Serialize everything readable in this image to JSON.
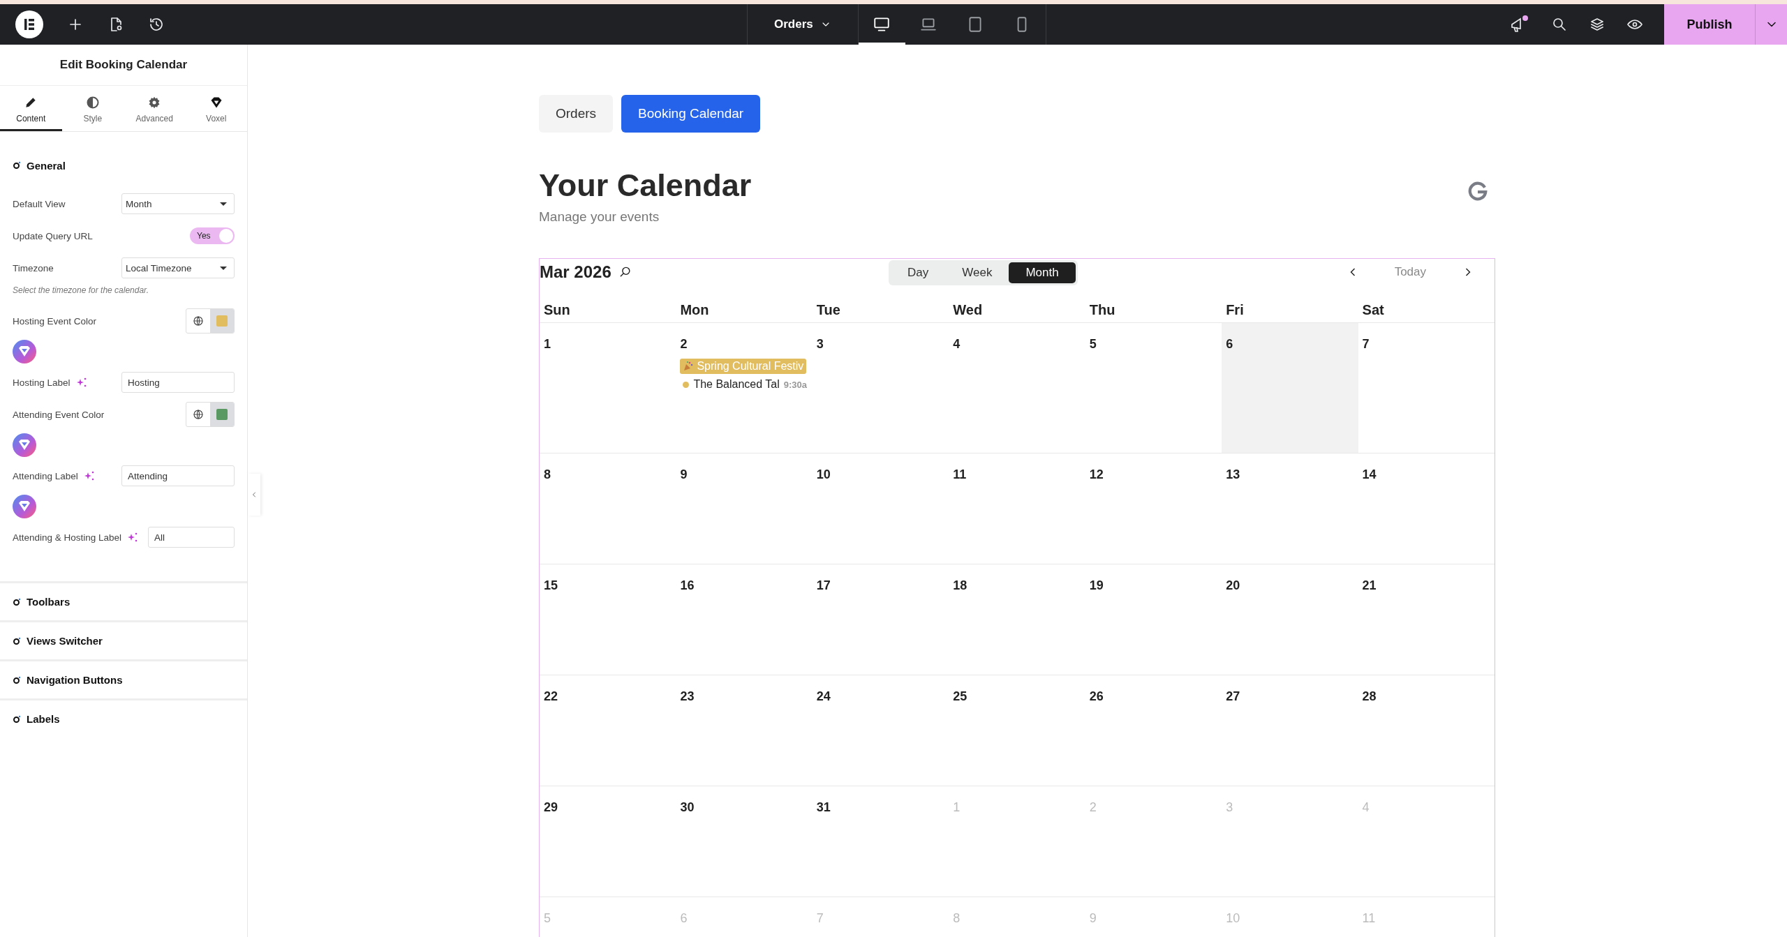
{
  "topbar": {
    "page_menu": "Orders",
    "devices": [
      {
        "kind": "desktop",
        "selected": true
      },
      {
        "kind": "laptop",
        "selected": false
      },
      {
        "kind": "tablet",
        "selected": false
      },
      {
        "kind": "mobile",
        "selected": false
      }
    ],
    "publish": "Publish"
  },
  "panel": {
    "title": "Edit Booking Calendar",
    "tabs": [
      {
        "kind": "pencil",
        "label": "Content",
        "selected": true
      },
      {
        "kind": "contrast",
        "label": "Style",
        "selected": false
      },
      {
        "kind": "gear",
        "label": "Advanced",
        "selected": false
      },
      {
        "kind": "voxel",
        "label": "Voxel",
        "selected": false
      }
    ],
    "general": {
      "title": "General",
      "rows": [
        {
          "kind": "select",
          "label": "Default View",
          "value": "Month"
        },
        {
          "kind": "toggle",
          "label": "Update Query URL",
          "value": "Yes",
          "on": true
        },
        {
          "kind": "select",
          "label": "Timezone",
          "value": "Local Timezone"
        },
        {
          "kind": "hint",
          "label": "Select the timezone for the calendar."
        },
        {
          "kind": "color",
          "label": "Hosting Event Color",
          "color": "#e2bd5f",
          "tag_icon": true
        },
        {
          "kind": "text",
          "label": "Hosting Label",
          "value": "Hosting"
        },
        {
          "kind": "color",
          "label": "Attending Event Color",
          "color": "#5a9a62",
          "tag_icon": true
        },
        {
          "kind": "text",
          "label": "Attending Label",
          "value": "Attending",
          "tag_icon": true
        },
        {
          "kind": "text",
          "label": "Attending & Hosting Label",
          "value": "All"
        }
      ]
    },
    "sections": [
      "Toolbars",
      "Views Switcher",
      "Navigation Buttons",
      "Labels"
    ]
  },
  "canvas": {
    "nav": [
      {
        "label": "Orders",
        "selected": false
      },
      {
        "label": "Booking Calendar",
        "selected": true
      }
    ],
    "heading": "Your Calendar",
    "subheading": "Manage your events",
    "calendar": {
      "title": "Mar 2026",
      "views": [
        {
          "label": "Day",
          "selected": false
        },
        {
          "label": "Week",
          "selected": false
        },
        {
          "label": "Month",
          "selected": true
        }
      ],
      "today": "Today",
      "weekdays": [
        "Sun",
        "Mon",
        "Tue",
        "Wed",
        "Thu",
        "Fri",
        "Sat"
      ],
      "weeks": [
        [
          {
            "day": "1",
            "outside": false
          },
          {
            "day": "2",
            "outside": false,
            "events": [
              {
                "kind": "bar",
                "title": "Spring Cultural Festiv",
                "color": "#e2bd5f"
              },
              {
                "kind": "dot",
                "title": "The Balanced Tal",
                "time": "9:30a",
                "color": "#e2bd5f"
              }
            ]
          },
          {
            "day": "3",
            "outside": false
          },
          {
            "day": "4",
            "outside": false
          },
          {
            "day": "5",
            "outside": false
          },
          {
            "day": "6",
            "outside": false,
            "highlighted": true
          },
          {
            "day": "7",
            "outside": false
          }
        ],
        [
          {
            "day": "8",
            "outside": false
          },
          {
            "day": "9",
            "outside": false
          },
          {
            "day": "10",
            "outside": false
          },
          {
            "day": "11",
            "outside": false
          },
          {
            "day": "12",
            "outside": false
          },
          {
            "day": "13",
            "outside": false
          },
          {
            "day": "14",
            "outside": false
          }
        ],
        [
          {
            "day": "15",
            "outside": false
          },
          {
            "day": "16",
            "outside": false
          },
          {
            "day": "17",
            "outside": false
          },
          {
            "day": "18",
            "outside": false
          },
          {
            "day": "19",
            "outside": false
          },
          {
            "day": "20",
            "outside": false
          },
          {
            "day": "21",
            "outside": false
          }
        ],
        [
          {
            "day": "22",
            "outside": false
          },
          {
            "day": "23",
            "outside": false
          },
          {
            "day": "24",
            "outside": false
          },
          {
            "day": "25",
            "outside": false
          },
          {
            "day": "26",
            "outside": false
          },
          {
            "day": "27",
            "outside": false
          },
          {
            "day": "28",
            "outside": false
          }
        ],
        [
          {
            "day": "29",
            "outside": false
          },
          {
            "day": "30",
            "outside": false
          },
          {
            "day": "31",
            "outside": false
          },
          {
            "day": "1",
            "outside": true
          },
          {
            "day": "2",
            "outside": true
          },
          {
            "day": "3",
            "outside": true
          },
          {
            "day": "4",
            "outside": true
          }
        ],
        [
          {
            "day": "5",
            "outside": true
          },
          {
            "day": "6",
            "outside": true
          },
          {
            "day": "7",
            "outside": true
          },
          {
            "day": "8",
            "outside": true
          },
          {
            "day": "9",
            "outside": true
          },
          {
            "day": "10",
            "outside": true
          },
          {
            "day": "11",
            "outside": true
          }
        ]
      ]
    }
  }
}
